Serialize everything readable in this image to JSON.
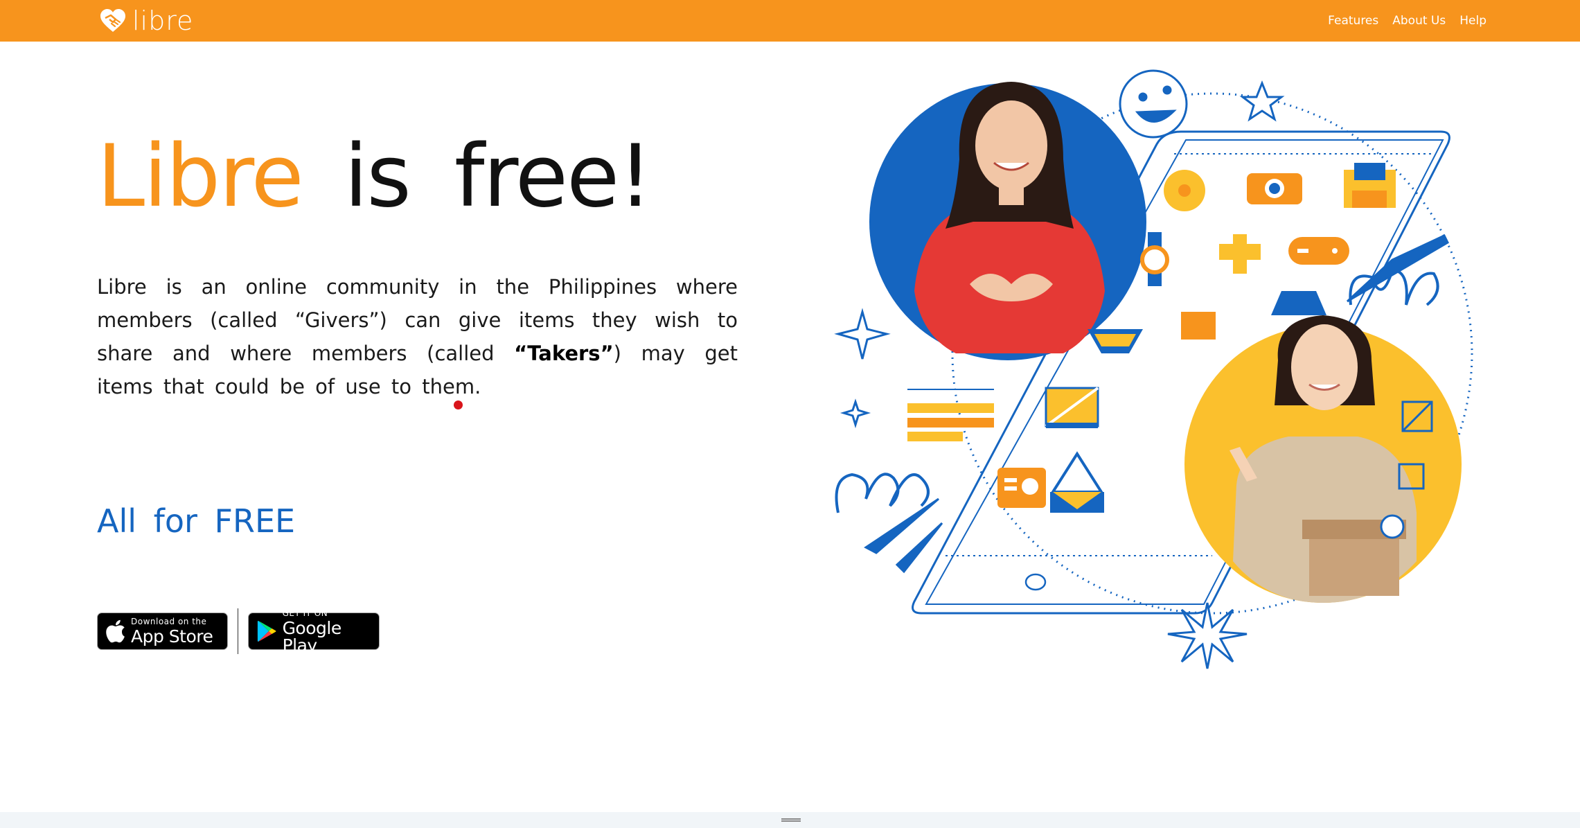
{
  "navbar": {
    "logo_text": "libre",
    "links": [
      "Features",
      "About Us",
      "Help"
    ],
    "background": "#f7941d"
  },
  "hero": {
    "title_brand": "Libre",
    "title_word1": "is",
    "title_word2": "free!",
    "description_part1": "Libre is an online community in the Philippines where members (called “Givers”) can give items they wish to share and where members (called ",
    "description_bold": "“Takers”",
    "description_part2": ") may get items that could be of use to them.",
    "tagline": "All for FREE"
  },
  "stores": {
    "appstore_small": "Download on the",
    "appstore_big": "App Store",
    "googleplay_small": "GET IT ON",
    "googleplay_big": "Google Play"
  },
  "icons": {
    "logo": "heart-handshake-icon",
    "apple": "apple-icon",
    "google_play": "google-play-icon"
  },
  "colors": {
    "accent": "#f7941d",
    "blue": "#1565c0",
    "yellow": "#fbc02d",
    "red_dot": "#d9151b"
  }
}
